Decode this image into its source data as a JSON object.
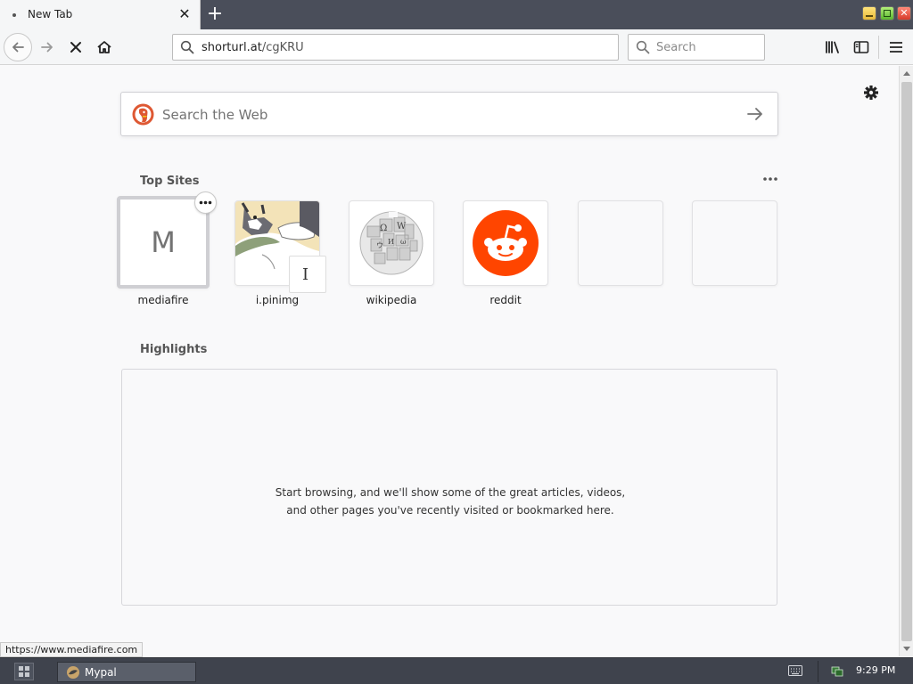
{
  "tab": {
    "title": "New Tab"
  },
  "navbar": {
    "url_host": "shorturl.at",
    "url_path": "/cgKRU",
    "search_placeholder": "Search"
  },
  "newtab": {
    "search_placeholder": "Search the Web",
    "top_sites_title": "Top Sites",
    "highlights_title": "Highlights",
    "highlights_message": "Start browsing, and we'll show some of the great articles, videos, and other pages you've recently visited or bookmarked here.",
    "sites": [
      {
        "label": "mediafire",
        "letter": "M"
      },
      {
        "label": "i.pinimg",
        "cursor": "I"
      },
      {
        "label": "wikipedia"
      },
      {
        "label": "reddit"
      },
      {
        "label": ""
      },
      {
        "label": ""
      }
    ]
  },
  "status": {
    "url": "https://www.mediafire.com"
  },
  "taskbar": {
    "task_label": "Mypal",
    "clock": "9:29 PM"
  },
  "colors": {
    "reddit": "#ff4500",
    "titlebar": "#4a4e5a",
    "taskbar": "#3f434d"
  },
  "icons": [
    "back-arrow-icon",
    "forward-arrow-icon",
    "stop-icon",
    "home-icon",
    "search-icon",
    "library-icon",
    "sidebar-icon",
    "hamburger-menu-icon",
    "gear-icon",
    "duckduckgo-logo",
    "arrow-right-icon",
    "more-dots-icon",
    "wikipedia-globe-logo",
    "reddit-logo",
    "keyboard-icon",
    "network-icon"
  ]
}
